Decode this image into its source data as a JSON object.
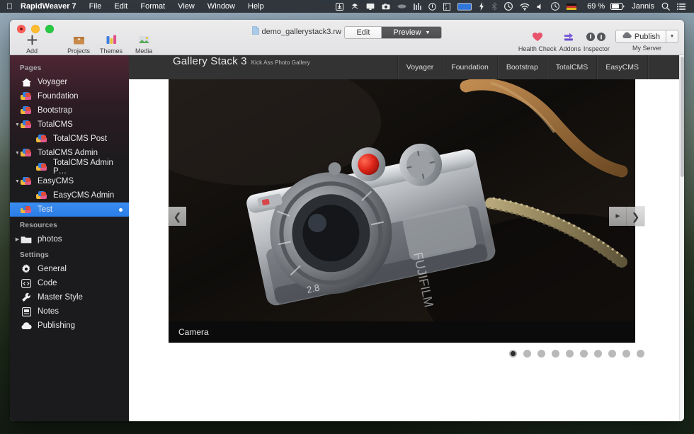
{
  "menubar": {
    "apple": "apple-logo",
    "app_name": "RapidWeaver 7",
    "items": [
      "File",
      "Edit",
      "Format",
      "View",
      "Window",
      "Help"
    ],
    "status_icons": [
      "screenshot-icon",
      "dropbox-icon",
      "display-icon",
      "camera-icon",
      "ellipse-icon",
      "equalizer-icon",
      "info-circle-icon",
      "flux-icon",
      "blue-display-icon",
      "lightning-icon",
      "bluetooth-icon",
      "timemachine-icon",
      "wifi-icon",
      "volume-icon",
      "clock-icon",
      "keyboard-flag-icon"
    ],
    "battery_percent": "69 %",
    "user": "Jannis",
    "search_icon": "search-icon",
    "notification_icon": "notification-list-icon"
  },
  "toolbar": {
    "left_buttons": [
      {
        "label": "Add",
        "icon": "plus-icon"
      },
      {
        "label": "Projects",
        "icon": "projects-icon"
      },
      {
        "label": "Themes",
        "icon": "themes-icon"
      },
      {
        "label": "Media",
        "icon": "media-icon"
      }
    ],
    "document_title": "demo_gallerystack3.rw",
    "document_icon": "document-icon",
    "segments": [
      {
        "label": "Edit",
        "active": false
      },
      {
        "label": "Preview",
        "active": true,
        "caret": "▼"
      }
    ],
    "right_buttons": [
      {
        "label": "Health Check",
        "icon": "heart-icon"
      },
      {
        "label": "Addons",
        "icon": "addons-icon"
      },
      {
        "label": "Inspector",
        "icon": "inspector-icon"
      }
    ],
    "publish": {
      "label": "Publish",
      "icon": "cloud-icon",
      "caret": "▼",
      "sublabel": "My Server"
    }
  },
  "sidebar": {
    "sections": [
      {
        "title": "Pages",
        "items": [
          {
            "label": "Voyager",
            "icon": "home-icon",
            "indent": 0,
            "twisty": "",
            "selected": false
          },
          {
            "label": "Foundation",
            "icon": "stacks-icon",
            "indent": 0,
            "twisty": "",
            "selected": false
          },
          {
            "label": "Bootstrap",
            "icon": "stacks-icon",
            "indent": 0,
            "twisty": "",
            "selected": false
          },
          {
            "label": "TotalCMS",
            "icon": "stacks-icon",
            "indent": 0,
            "twisty": "▼",
            "selected": false
          },
          {
            "label": "TotalCMS Post",
            "icon": "stacks-icon",
            "indent": 1,
            "twisty": "",
            "selected": false
          },
          {
            "label": "TotalCMS Admin",
            "icon": "stacks-icon",
            "indent": 0,
            "twisty": "▼",
            "selected": false
          },
          {
            "label": "TotalCMS Admin P…",
            "icon": "stacks-icon",
            "indent": 1,
            "twisty": "",
            "selected": false
          },
          {
            "label": "EasyCMS",
            "icon": "stacks-icon",
            "indent": 0,
            "twisty": "▼",
            "selected": false
          },
          {
            "label": "EasyCMS Admin",
            "icon": "stacks-icon",
            "indent": 1,
            "twisty": "",
            "selected": false
          },
          {
            "label": "Test",
            "icon": "stacks-icon",
            "indent": 0,
            "twisty": "",
            "selected": true,
            "badge_dot": true
          }
        ]
      },
      {
        "title": "Resources",
        "items": [
          {
            "label": "photos",
            "icon": "folder-icon",
            "indent": 0,
            "twisty": "▶",
            "selected": false
          }
        ]
      },
      {
        "title": "Settings",
        "items": [
          {
            "label": "General",
            "icon": "gear-icon",
            "indent": 0,
            "twisty": "",
            "selected": false
          },
          {
            "label": "Code",
            "icon": "code-icon",
            "indent": 0,
            "twisty": "",
            "selected": false
          },
          {
            "label": "Master Style",
            "icon": "wrench-icon",
            "indent": 0,
            "twisty": "",
            "selected": false
          },
          {
            "label": "Notes",
            "icon": "notes-icon",
            "indent": 0,
            "twisty": "",
            "selected": false
          },
          {
            "label": "Publishing",
            "icon": "cloud-icon",
            "indent": 0,
            "twisty": "",
            "selected": false
          }
        ]
      }
    ]
  },
  "preview": {
    "brand_title": "Gallery Stack 3",
    "brand_tagline": "Kick Ass Photo Gallery",
    "nav": [
      "Voyager",
      "Foundation",
      "Bootstrap",
      "TotalCMS",
      "EasyCMS"
    ],
    "gallery": {
      "caption": "Camera",
      "prev_icon": "chevron-left-icon",
      "play_icon": "play-icon",
      "next_icon": "chevron-right-icon",
      "dot_count": 10,
      "active_dot": 1,
      "image_alt": "silver-film-camera-on-dark-fabric"
    }
  },
  "colors": {
    "accent_blue": "#2b7de8",
    "site_header": "#333334",
    "caption_bar": "#0b0b0b",
    "sidebar_bg": "#1b1b1d",
    "toolbar_bg": "#e6e6e8"
  }
}
